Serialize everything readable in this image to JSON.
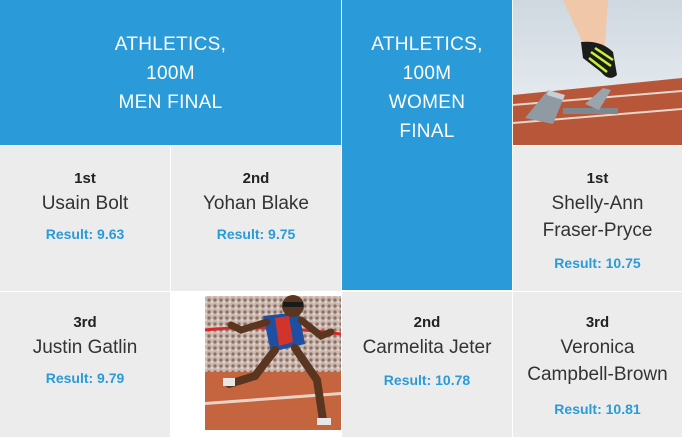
{
  "men_title": {
    "line1": "ATHLETICS,",
    "line2": "100M",
    "line3": "MEN FINAL"
  },
  "women_title": {
    "line1": "ATHLETICS,",
    "line2": "100M",
    "line3": "WOMEN",
    "line4": "FINAL"
  },
  "result_label": "Result: ",
  "men": [
    {
      "rank": "1st",
      "name": "Usain Bolt",
      "result": "9.63"
    },
    {
      "rank": "2nd",
      "name": "Yohan Blake",
      "result": "9.75"
    },
    {
      "rank": "3rd",
      "name": "Justin Gatlin",
      "result": "9.79"
    }
  ],
  "women": [
    {
      "rank": "1st",
      "name_line1": "Shelly-Ann",
      "name_line2": "Fraser-Pryce",
      "result": "10.75"
    },
    {
      "rank": "2nd",
      "name": "Carmelita Jeter",
      "result": "10.78"
    },
    {
      "rank": "3rd",
      "name_line1": "Veronica",
      "name_line2": "Campbell-Brown",
      "result": "10.81"
    }
  ],
  "colors": {
    "accent": "#2a9bd8",
    "tile_gray": "#ececec",
    "text_dark": "#333333"
  },
  "images": {
    "sprinter_start": "starting-block-photo",
    "sprinter_finish": "finish-line-photo"
  }
}
